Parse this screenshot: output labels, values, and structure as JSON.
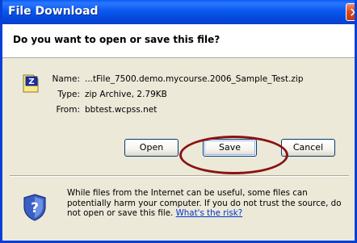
{
  "window": {
    "title": "File Download",
    "close_label": "✕"
  },
  "prompt": {
    "question": "Do you want to open or save this file?"
  },
  "file": {
    "icon": "zip-file-icon",
    "name_label": "Name:",
    "name_value": "...tFile_7500.demo.mycourse.2006_Sample_Test.zip",
    "type_label": "Type:",
    "type_value": "zip Archive, 2.79KB",
    "from_label": "From:",
    "from_value": "bbtest.wcpss.net"
  },
  "buttons": {
    "open": "Open",
    "save": "Save",
    "cancel": "Cancel"
  },
  "warning": {
    "icon": "shield-question-icon",
    "text": "While files from the Internet can be useful, some files can potentially harm your computer. If you do not trust the source, do not open or save this file. ",
    "link": "What's the risk?"
  },
  "colors": {
    "titlebar": "#0a59ee",
    "highlight_ellipse": "#8b1212",
    "link": "#0033cc"
  }
}
